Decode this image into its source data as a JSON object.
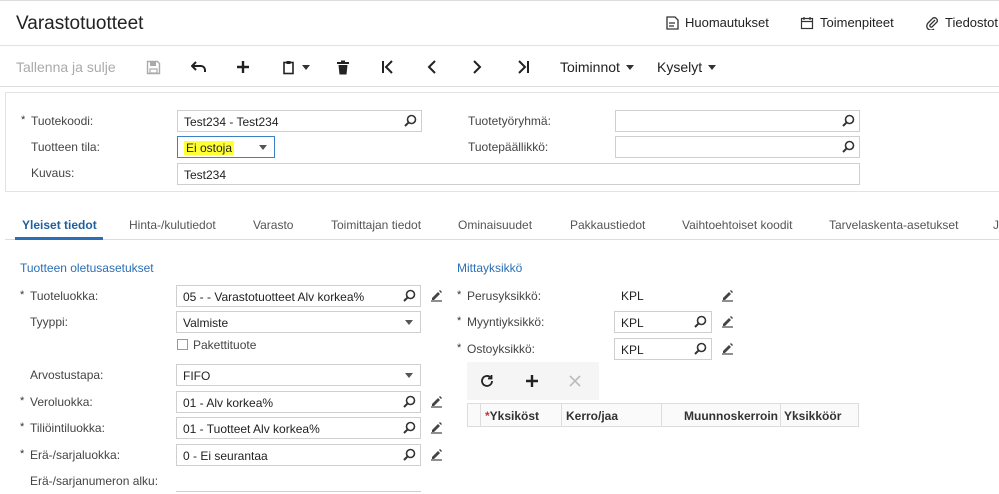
{
  "header": {
    "title": "Varastotuotteet",
    "links": [
      "Huomautukset",
      "Toimenpiteet",
      "Tiedostot"
    ]
  },
  "toolbar": {
    "save_close": "Tallenna ja sulje",
    "actions": "Toiminnot",
    "queries": "Kyselyt"
  },
  "summary": {
    "item_code_label": "Tuotekoodi:",
    "item_code_value": "Test234 - Test234",
    "item_status_label": "Tuotteen tila:",
    "item_status_value": "Ei ostoja",
    "description_label": "Kuvaus:",
    "description_value": "Test234",
    "product_workgroup_label": "Tuotetyöryhmä:",
    "product_workgroup_value": "",
    "product_manager_label": "Tuotepäällikkö:",
    "product_manager_value": ""
  },
  "tabs": [
    "Yleiset tiedot",
    "Hinta-/kulutiedot",
    "Varasto",
    "Toimittajan tiedot",
    "Ominaisuudet",
    "Pakkaustiedot",
    "Vaihtoehtoiset koodit",
    "Tarvelaskenta-asetukset",
    "J"
  ],
  "defaults": {
    "section_title": "Tuotteen oletusasetukset",
    "item_class_label": "Tuoteluokka:",
    "item_class_value": "05  - - Varastotuotteet Alv korkea%",
    "type_label": "Tyyppi:",
    "type_value": "Valmiste",
    "kit_label": "Pakettituote",
    "valuation_label": "Arvostustapa:",
    "valuation_value": "FIFO",
    "tax_class_label": "Veroluokka:",
    "tax_class_value": "01 - Alv korkea%",
    "posting_class_label": "Tiliöintiluokka:",
    "posting_class_value": "01 - Tuotteet Alv korkea%",
    "lot_serial_class_label": "Erä-/sarjaluokka:",
    "lot_serial_class_value": "0 - Ei seurantaa",
    "lot_serial_start_label": "Erä-/sarjanumeron alku:"
  },
  "uom": {
    "section_title": "Mittayksikkö",
    "base_label": "Perusyksikkö:",
    "base_value": "KPL",
    "sales_label": "Myyntiyksikkö:",
    "sales_value": "KPL",
    "purchase_label": "Ostoyksikkö:",
    "purchase_value": "KPL",
    "grid_columns": [
      "Yksiköst",
      "Kerro/jaa",
      "Muunnoskerroin",
      "Yksikköör"
    ]
  },
  "colors": {
    "accent": "#2a6fb5",
    "highlight": "#ffff33"
  }
}
